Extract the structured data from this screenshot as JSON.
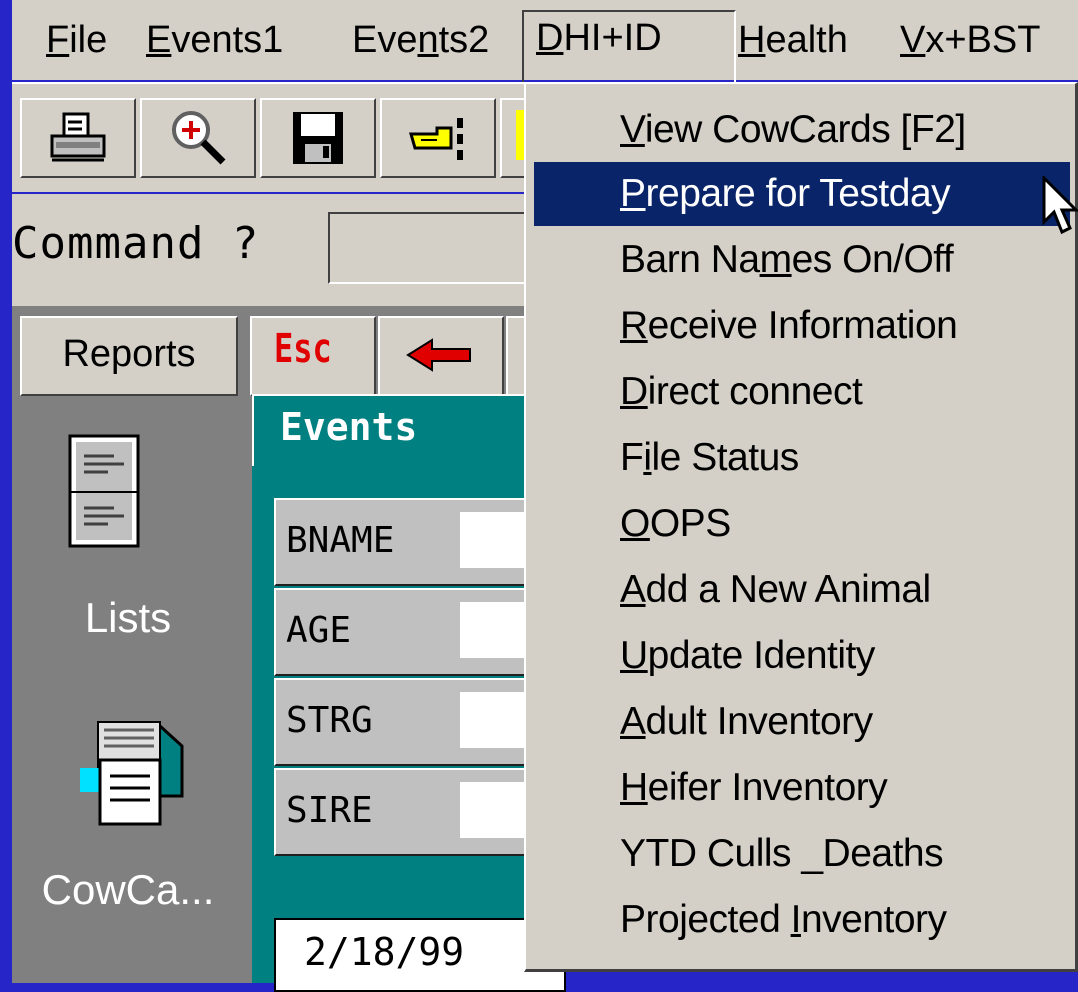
{
  "menubar": {
    "items": [
      {
        "pre": "",
        "u": "F",
        "post": "ile"
      },
      {
        "pre": "",
        "u": "E",
        "post": "vents1"
      },
      {
        "pre": "Eve",
        "u": "n",
        "post": "ts2"
      },
      {
        "pre": "",
        "u": "D",
        "post": "HI+ID"
      },
      {
        "pre": "",
        "u": "H",
        "post": "ealth"
      },
      {
        "pre": "",
        "u": "V",
        "post": "x+BST"
      }
    ]
  },
  "toolbar": {
    "icons": [
      "printer-icon",
      "magnifier-icon",
      "floppy-disk-icon",
      "pointing-hand-icon"
    ]
  },
  "command": {
    "label": "Command ?",
    "value": ""
  },
  "sidebar": {
    "reports_label": "Reports",
    "items": [
      {
        "label": "Lists",
        "icon": "list-document-icon"
      },
      {
        "label": "CowCa...",
        "icon": "card-file-icon"
      }
    ]
  },
  "nav": {
    "esc_label": "Esc"
  },
  "events_tab": {
    "label": "Events",
    "fields": [
      {
        "label": "BNAME",
        "value": ""
      },
      {
        "label": "AGE",
        "value": ""
      },
      {
        "label": "STRG",
        "value": ""
      },
      {
        "label": "SIRE",
        "value": ""
      }
    ],
    "date": "2/18/99"
  },
  "dropdown": {
    "items": [
      {
        "pre": "",
        "u": "V",
        "post": "iew CowCards [F2]"
      },
      {
        "pre": "",
        "u": "P",
        "post": "repare for Testday",
        "highlighted": true
      },
      {
        "pre": "Barn Na",
        "u": "m",
        "post": "es On/Off"
      },
      {
        "pre": "",
        "u": "R",
        "post": "eceive Information"
      },
      {
        "pre": "",
        "u": "D",
        "post": "irect connect"
      },
      {
        "pre": "F",
        "u": "i",
        "post": "le Status"
      },
      {
        "pre": "",
        "u": "O",
        "post": "OPS"
      },
      {
        "pre": "",
        "u": "A",
        "post": "dd a New Animal"
      },
      {
        "pre": "",
        "u": "U",
        "post": "pdate Identity"
      },
      {
        "pre": "",
        "u": "A",
        "post": "dult Inventory"
      },
      {
        "pre": "",
        "u": "H",
        "post": "eifer Inventory"
      },
      {
        "pre": "",
        "u": "",
        "post": "YTD Culls _Deaths"
      },
      {
        "pre": "Projected ",
        "u": "I",
        "post": "nventory"
      }
    ]
  },
  "colors": {
    "window_bg": "#d4d0c8",
    "desktop_blue": "#2626c8",
    "highlight": "#0a246a",
    "teal": "#008080"
  }
}
